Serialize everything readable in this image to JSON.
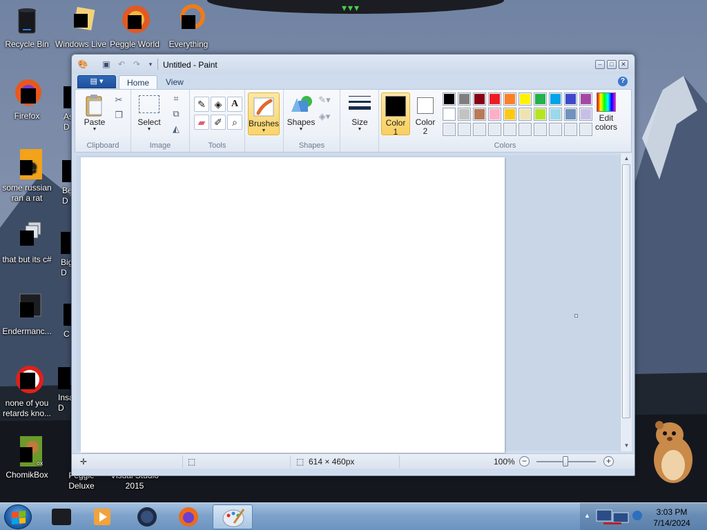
{
  "desktop": {
    "icons": [
      {
        "label": "Recycle Bin"
      },
      {
        "label": "Windows Live"
      },
      {
        "label": "Peggle World"
      },
      {
        "label": "Everything"
      },
      {
        "label": "Firefox"
      },
      {
        "label": "some russian ran a rat"
      },
      {
        "label": "that but its c#"
      },
      {
        "label": "Endermanc..."
      },
      {
        "label": "none of you retards kno..."
      },
      {
        "label": "ChomikBox"
      },
      {
        "label": "Peggle Deluxe"
      },
      {
        "label": "Visual Studio 2015"
      }
    ],
    "partial_icons": [
      {
        "label": "As D"
      },
      {
        "label": "Be D"
      },
      {
        "label": "Big D"
      },
      {
        "label": "C D"
      },
      {
        "label": "Insa D"
      }
    ]
  },
  "window": {
    "title": "Untitled - Paint",
    "controls": {
      "minimize": "–",
      "maximize": "□",
      "close": "✕"
    }
  },
  "ribbon": {
    "file_tab": "▤ ▾",
    "tabs": [
      {
        "label": "Home"
      },
      {
        "label": "View"
      }
    ],
    "help": "?",
    "groups": {
      "clipboard": {
        "label": "Clipboard",
        "paste": "Paste"
      },
      "image": {
        "label": "Image",
        "select": "Select"
      },
      "tools": {
        "label": "Tools"
      },
      "brushes": {
        "label": "Brushes"
      },
      "shapes": {
        "label": "Shapes",
        "shapes_btn": "Shapes"
      },
      "size": {
        "label": "Size"
      },
      "colors": {
        "label": "Colors",
        "color1": "Color 1",
        "color2": "Color 2",
        "edit_colors": "Edit colors",
        "color1_value": "#000000",
        "color2_value": "#ffffff",
        "palette_row1": [
          "#000000",
          "#7f7f7f",
          "#880015",
          "#ed1c24",
          "#ff7f27",
          "#fff200",
          "#22b14c",
          "#00a2e8",
          "#3f48cc",
          "#a349a4"
        ],
        "palette_row2": [
          "#ffffff",
          "#c3c3c3",
          "#b97a57",
          "#ffaec9",
          "#ffc90e",
          "#efe4b0",
          "#b5e61d",
          "#99d9ea",
          "#7092be",
          "#c8bfe7"
        ]
      }
    }
  },
  "statusbar": {
    "dimensions": "614 × 460px",
    "zoom": "100%",
    "zoom_level": 1.0
  },
  "taskbar": {
    "time": "3:03 PM",
    "date": "7/14/2024"
  }
}
